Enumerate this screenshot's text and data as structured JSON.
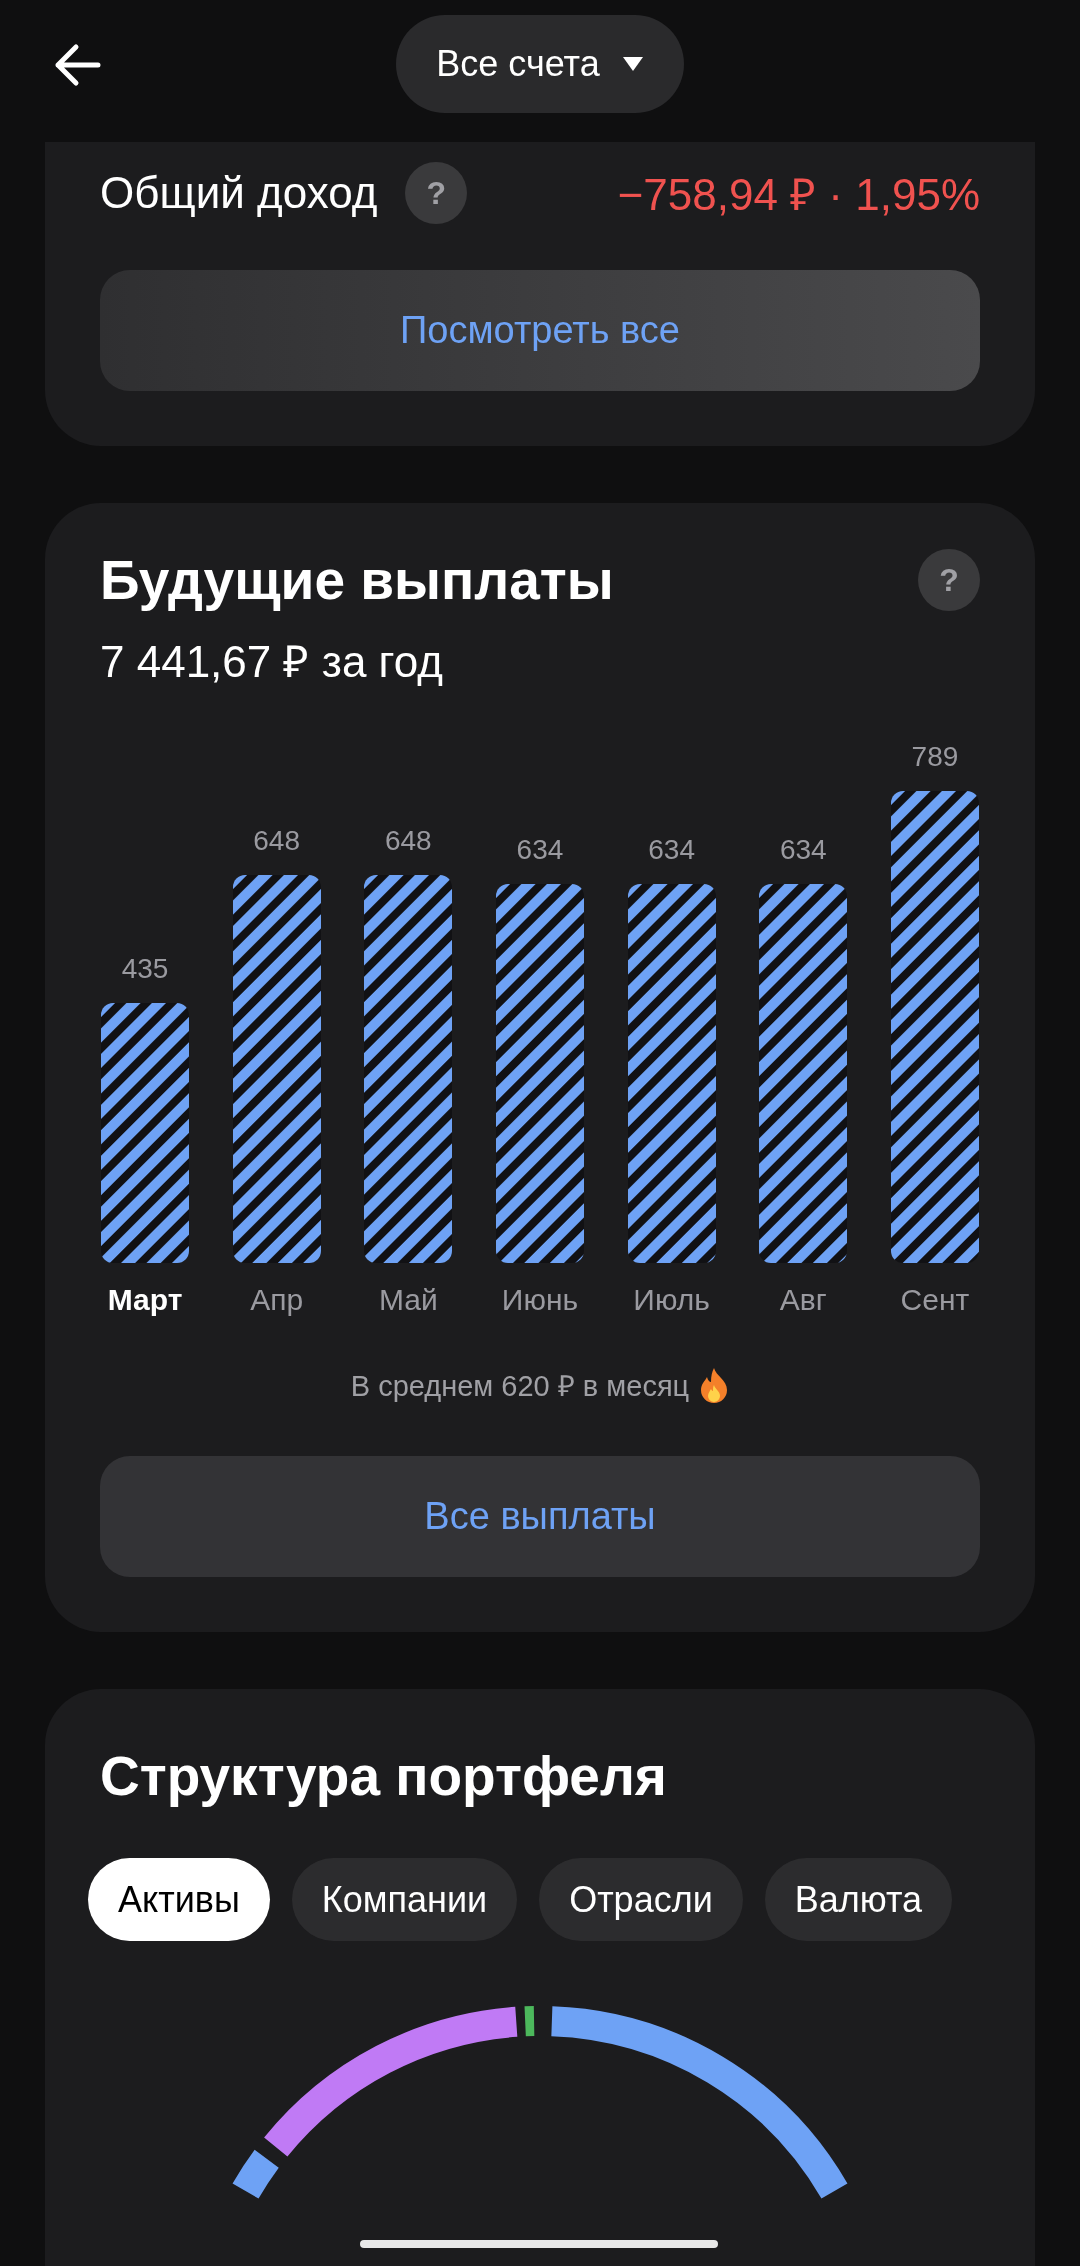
{
  "header": {
    "account_selector": "Все счета"
  },
  "income": {
    "label": "Общий доход",
    "help": "?",
    "value": "−758,94 ₽ · 1,95%",
    "button": "Посмотреть все"
  },
  "payouts": {
    "title": "Будущие выплаты",
    "help": "?",
    "total": "7 441,67 ₽ за год",
    "chart_data": {
      "type": "bar",
      "categories": [
        "Март",
        "Апр",
        "Май",
        "Июнь",
        "Июль",
        "Авг",
        "Сент"
      ],
      "values": [
        435,
        648,
        648,
        634,
        634,
        634,
        789
      ],
      "data_labels": true
    },
    "categories_selected": [
      true,
      false,
      false,
      false,
      false,
      false,
      false
    ],
    "average": "В среднем 620 ₽ в месяц",
    "button": "Все выплаты"
  },
  "structure": {
    "title": "Структура портфеля",
    "tabs": [
      {
        "label": "Активы",
        "selected": true
      },
      {
        "label": "Компании",
        "selected": false
      },
      {
        "label": "Отрасли",
        "selected": false
      },
      {
        "label": "Валюта",
        "selected": false
      }
    ]
  }
}
